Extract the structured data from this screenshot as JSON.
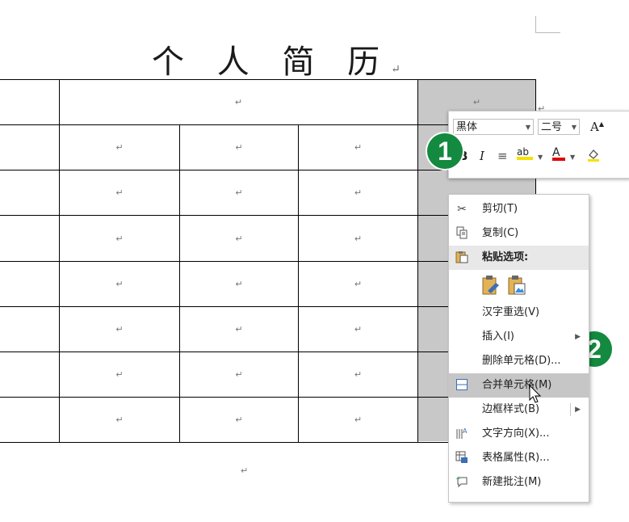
{
  "document": {
    "title": "个 人 简 历",
    "paragraph_mark": "↵",
    "table": {
      "row_count": 8,
      "columns_visible": 5,
      "merged_first_row": true
    }
  },
  "mini_toolbar": {
    "font_name": "黑体",
    "font_size": "二号",
    "grow_font": "A",
    "bold": "B",
    "italic": "I",
    "align": "≡",
    "highlight": "ab",
    "font_color": "A",
    "accent_highlight": "#f5e100",
    "accent_font_color": "#e00000"
  },
  "badges": {
    "one": "1",
    "two": "2",
    "color": "#138a3f"
  },
  "context_menu": {
    "items": [
      {
        "label": "剪切(T)",
        "icon": "scissors-icon"
      },
      {
        "label": "复制(C)",
        "icon": "copy-icon"
      },
      {
        "label": "粘贴选项:",
        "icon": "paste-icon"
      },
      {
        "label": "汉字重选(V)",
        "icon": ""
      },
      {
        "label": "插入(I)",
        "icon": ""
      },
      {
        "label": "删除单元格(D)...",
        "icon": ""
      },
      {
        "label": "合并单元格(M)",
        "icon": "merge-cells-icon"
      },
      {
        "label": "边框样式(B)",
        "icon": ""
      },
      {
        "label": "文字方向(X)...",
        "icon": "text-direction-icon"
      },
      {
        "label": "表格属性(R)...",
        "icon": "table-properties-icon"
      },
      {
        "label": "新建批注(M)",
        "icon": "new-comment-icon"
      }
    ],
    "highlight_color": "#c6c6c6"
  }
}
